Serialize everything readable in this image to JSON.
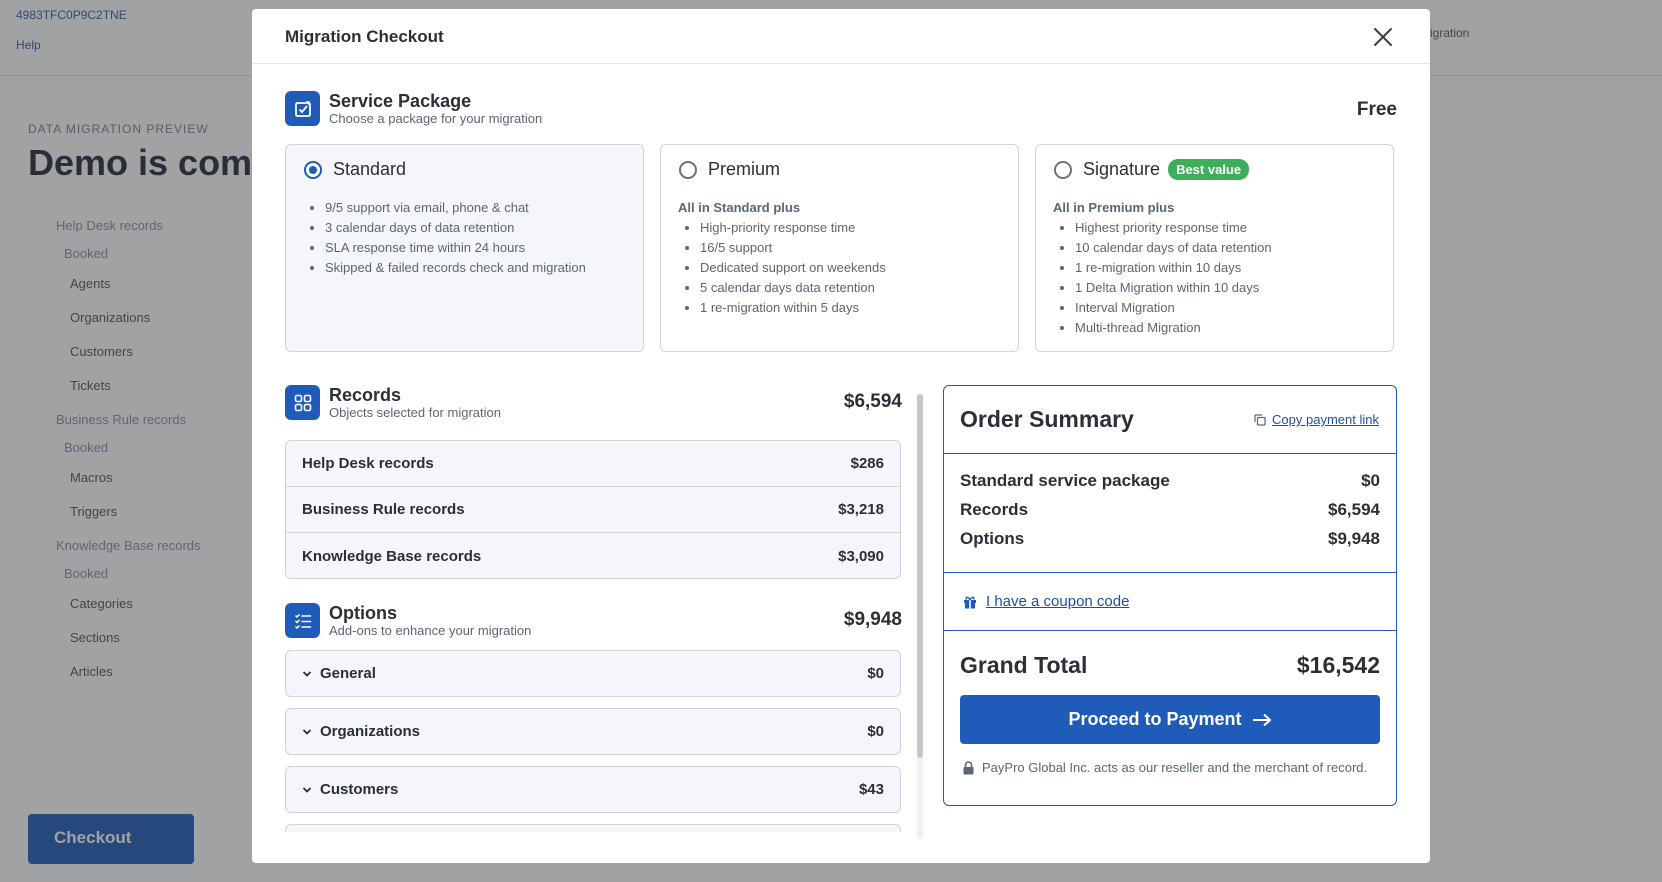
{
  "background": {
    "instance_id": "4983TFC0P9C2TNE",
    "help": "Help",
    "eyebrow": "DATA MIGRATION PREVIEW",
    "title": "Demo is complete",
    "sections": [
      {
        "title": "Help Desk records",
        "header": "Booked",
        "rows": [
          "Agents",
          "Organizations",
          "Customers",
          "Tickets"
        ]
      },
      {
        "title": "Business Rule records",
        "header": "Booked",
        "rows": [
          "Macros",
          "Triggers"
        ]
      },
      {
        "title": "Knowledge Base records",
        "header": "Booked",
        "rows": [
          "Categories",
          "Sections",
          "Articles"
        ]
      }
    ],
    "checkout_label": "Checkout",
    "right_text": "Migration"
  },
  "modal": {
    "title": "Migration Checkout",
    "service_package": {
      "title": "Service Package",
      "subtitle": "Choose a package for your migration",
      "price": "Free",
      "packages": [
        {
          "name": "Standard",
          "selected": true,
          "intro": "",
          "features": [
            "9/5 support via email, phone & chat",
            "3 calendar days of data retention",
            "SLA response time within 24 hours",
            "Skipped & failed records check and migration"
          ]
        },
        {
          "name": "Premium",
          "selected": false,
          "intro": "All in Standard plus",
          "features": [
            "High-priority response time",
            "16/5 support",
            "Dedicated support on weekends",
            "5 calendar days data retention",
            "1 re-migration within 5 days"
          ]
        },
        {
          "name": "Signature",
          "selected": false,
          "badge": "Best value",
          "intro": "All in Premium plus",
          "features": [
            "Highest priority response time",
            "10 calendar days of data retention",
            "1 re-migration within 10 days",
            "1 Delta Migration within 10 days",
            "Interval Migration",
            "Multi-thread Migration"
          ]
        }
      ]
    },
    "records": {
      "title": "Records",
      "subtitle": "Objects selected for migration",
      "price": "$6,594",
      "rows": [
        {
          "label": "Help Desk records",
          "price": "$286"
        },
        {
          "label": "Business Rule records",
          "price": "$3,218"
        },
        {
          "label": "Knowledge Base records",
          "price": "$3,090"
        }
      ]
    },
    "options": {
      "title": "Options",
      "subtitle": "Add-ons to enhance your migration",
      "price": "$9,948",
      "rows": [
        {
          "label": "General",
          "price": "$0"
        },
        {
          "label": "Organizations",
          "price": "$0"
        },
        {
          "label": "Customers",
          "price": "$43"
        }
      ]
    },
    "summary": {
      "title": "Order Summary",
      "copy_link": "Copy payment link",
      "lines": [
        {
          "label": "Standard service package",
          "value": "$0"
        },
        {
          "label": "Records",
          "value": "$6,594"
        },
        {
          "label": "Options",
          "value": "$9,948"
        }
      ],
      "coupon": "I have a coupon code",
      "grand_label": "Grand Total",
      "grand_value": "$16,542",
      "pay_button": "Proceed to Payment",
      "merchant_note": "PayPro Global Inc. acts as our reseller and the merchant of record."
    }
  },
  "colors": {
    "accent": "#1f5bb8",
    "badge": "#3fae5a",
    "link": "#1f4f9c"
  }
}
